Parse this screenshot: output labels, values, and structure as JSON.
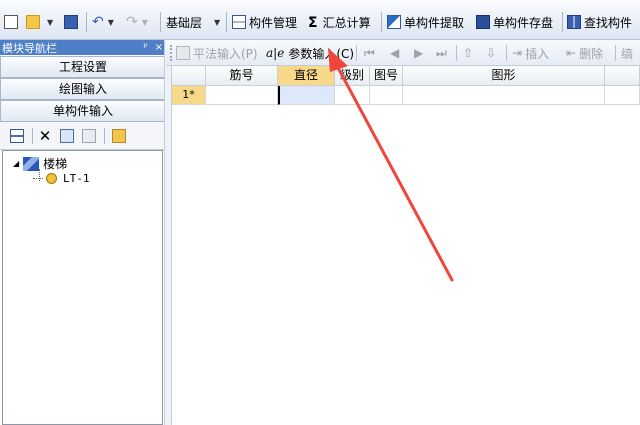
{
  "toolbar": {
    "floor_dropdown": "基础层",
    "component_manage": "构件管理",
    "summary_calc": "汇总计算",
    "single_extract": "单构件提取",
    "single_save": "单构件存盘",
    "find_component": "查找构件"
  },
  "nav": {
    "header_title": "模块导航栏",
    "pin_symbol": "ᵖ",
    "close_symbol": "×",
    "sections": [
      "工程设置",
      "绘图输入",
      "单构件输入"
    ]
  },
  "tree": {
    "root": "楼梯",
    "child": "LT-1"
  },
  "right_toolbar": {
    "flat_input": "平法输入(P)",
    "param_input": "参数输入(C)",
    "insert": "插入",
    "delete": "删除",
    "truncated": "缟"
  },
  "grid": {
    "columns": [
      "筋号",
      "直径(mm)",
      "级别",
      "图号",
      "图形"
    ],
    "row_label": "1*"
  },
  "colors": {
    "accent": "#4f7fc7",
    "arrow": "#f0453d",
    "selected_header": "#f8d98a"
  }
}
